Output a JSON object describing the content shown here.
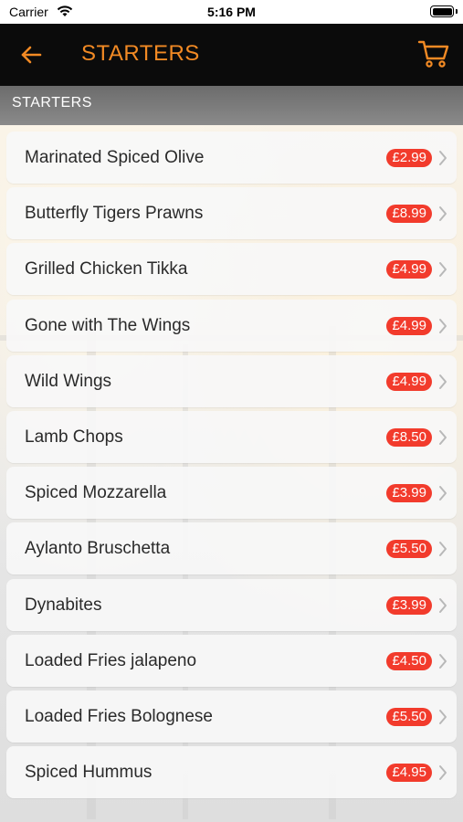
{
  "status_bar": {
    "carrier": "Carrier",
    "time": "5:16 PM"
  },
  "nav": {
    "title": "STARTERS"
  },
  "section": {
    "title": "STARTERS"
  },
  "colors": {
    "accent": "#f28a24",
    "price_badge": "#f23b2c",
    "nav_bg": "#0b0b0b"
  },
  "icons": {
    "back": "arrow-left-icon",
    "cart": "cart-icon",
    "chevron": "chevron-right-icon"
  },
  "menu": {
    "items": [
      {
        "name": "Marinated Spiced Olive",
        "price": "£2.99"
      },
      {
        "name": "Butterfly Tigers Prawns",
        "price": "£8.99"
      },
      {
        "name": "Grilled Chicken Tikka",
        "price": "£4.99"
      },
      {
        "name": "Gone with The Wings",
        "price": "£4.99"
      },
      {
        "name": "Wild Wings",
        "price": "£4.99"
      },
      {
        "name": "Lamb Chops",
        "price": "£8.50"
      },
      {
        "name": "Spiced Mozzarella",
        "price": "£3.99"
      },
      {
        "name": "Aylanto Bruschetta",
        "price": "£5.50"
      },
      {
        "name": "Dynabites",
        "price": "£3.99"
      },
      {
        "name": "Loaded Fries jalapeno",
        "price": "£4.50"
      },
      {
        "name": "Loaded Fries Bolognese",
        "price": "£5.50"
      },
      {
        "name": "Spiced Hummus",
        "price": "£4.95"
      }
    ]
  }
}
